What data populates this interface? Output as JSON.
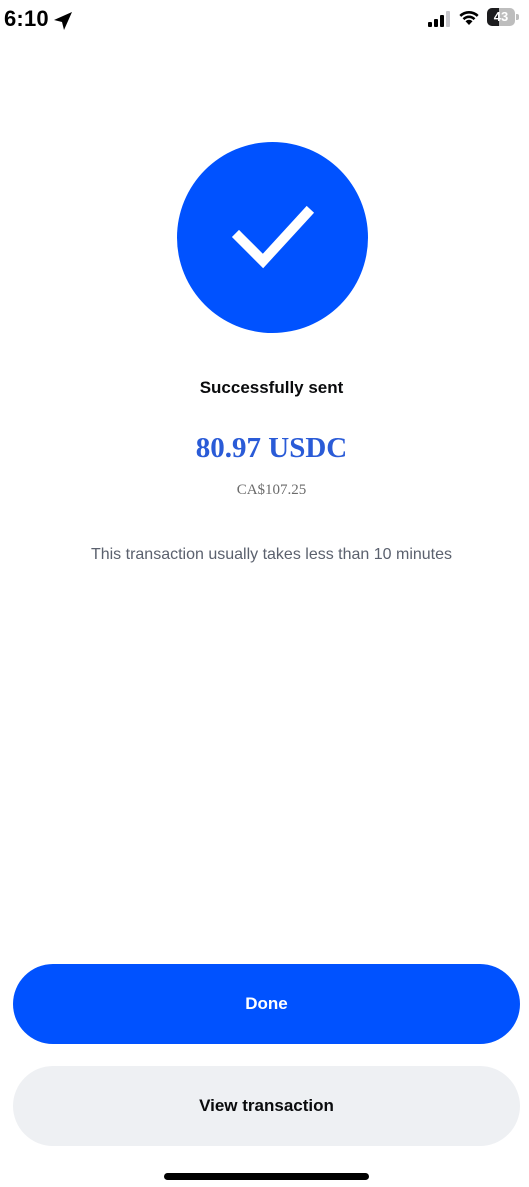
{
  "status_bar": {
    "time": "6:10",
    "battery_percent": "43",
    "battery_level": 0.43,
    "icons": [
      "location-arrow-icon",
      "cellular-signal-icon",
      "wifi-icon",
      "battery-icon"
    ]
  },
  "success": {
    "icon": "checkmark-icon",
    "title": "Successfully sent",
    "amount": "80.97 USDC",
    "fiat_amount": "CA$107.25",
    "note": "This transaction usually takes less than 10 minutes"
  },
  "actions": {
    "done_label": "Done",
    "view_label": "View transaction"
  },
  "colors": {
    "primary_blue": "#0052ff",
    "amount_blue": "#2a5bd7",
    "secondary_button_bg": "#eef0f3",
    "muted_text": "#5b616e"
  }
}
